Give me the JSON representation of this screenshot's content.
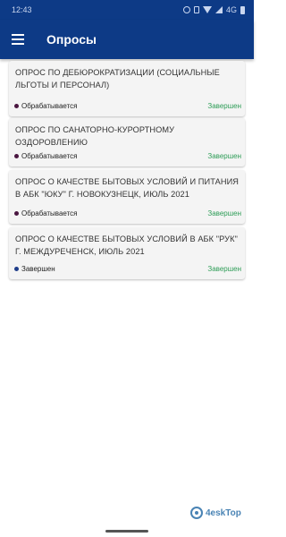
{
  "status_bar": {
    "time": "12:43",
    "indicator": "4G"
  },
  "app_bar": {
    "menu_icon": "hamburger-menu-icon",
    "title": "Опросы"
  },
  "colors": {
    "primary": "#0d3a86",
    "in_progress_dot": "#4a1640",
    "completed_dot": "#1f3d8a",
    "completed_text": "#2e9d57"
  },
  "surveys": [
    {
      "title": "ОПРОС ПО ДЕБЮРОКРАТИЗАЦИИ (СОЦИАЛЬНЫЕ ЛЬГОТЫ И ПЕРСОНАЛ)",
      "status": "Обрабатывается",
      "result": "Завершен"
    },
    {
      "title": "ОПРОС ПО САНАТОРНО-КУРОРТНОМУ ОЗДОРОВЛЕНИЮ",
      "status": "Обрабатывается",
      "result": "Завершен"
    },
    {
      "title": "ОПРОС О КАЧЕСТВЕ БЫТОВЫХ УСЛОВИЙ И ПИТАНИЯ В АБК \"ЮКУ\" Г. НОВОКУЗНЕЦК, ИЮЛЬ 2021",
      "status": "Обрабатывается",
      "result": "Завершен"
    },
    {
      "title": "ОПРОС О КАЧЕСТВЕ БЫТОВЫХ УСЛОВИЙ В АБК \"РУК\" Г. МЕЖДУРЕЧЕНСК, ИЮЛЬ 2021",
      "status": "Завершен",
      "result": "Завершен"
    }
  ],
  "watermark": {
    "text": "4eskTop"
  }
}
